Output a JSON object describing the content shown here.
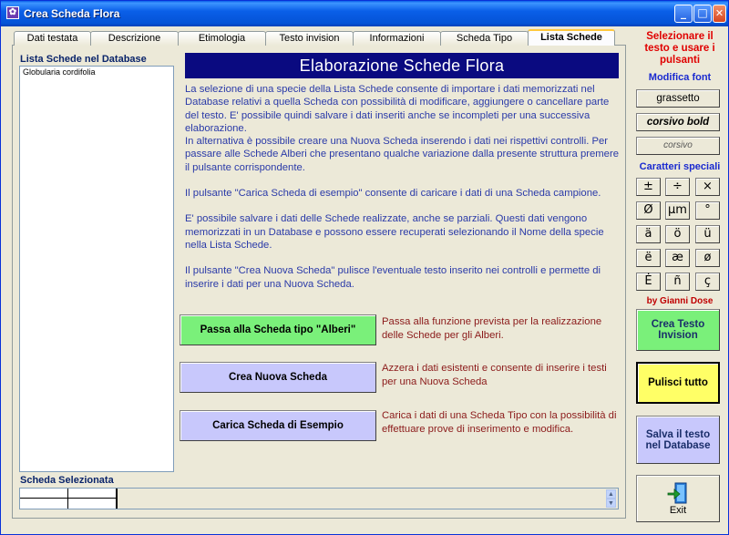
{
  "window": {
    "title": "Crea Scheda Flora"
  },
  "tabs": [
    {
      "label": "Dati testata"
    },
    {
      "label": "Descrizione"
    },
    {
      "label": "Etimologia"
    },
    {
      "label": "Testo invision"
    },
    {
      "label": "Informazioni"
    },
    {
      "label": "Scheda Tipo"
    },
    {
      "label": "Lista Schede"
    }
  ],
  "list": {
    "label": "Lista Schede nel Database",
    "items": [
      "Globularia cordifolia"
    ]
  },
  "main": {
    "header": "Elaborazione Schede Flora",
    "paragraphs": [
      "La selezione di una specie della Lista Schede consente di importare i dati memorizzati nel Database relativi a quella Scheda con possibilità di modificare, aggiungere o cancellare parte del testo. E' possibile quindi salvare i dati inseriti anche se incompleti per una successiva elaborazione.",
      "In alternativa è possibile creare una Nuova Scheda inserendo i dati nei rispettivi controlli. Per passare alle Schede Alberi che presentano qualche variazione dalla presente struttura premere il pulsante corrispondente.",
      "Il pulsante \"Carica Scheda di esempio\" consente di caricare i dati di una Scheda campione.",
      "E' possibile salvare i dati delle Schede realizzate, anche se parziali. Questi dati vengono memorizzati in un Database e possono essere recuperati selezionando il Nome della specie nella Lista Schede.",
      "Il pulsante \"Crea Nuova Scheda\" pulisce l'eventuale testo inserito nei controlli e permette di inserire i dati per una Nuova Scheda."
    ],
    "actions": {
      "alberi": {
        "label": "Passa alla Scheda tipo \"Alberi\"",
        "desc": "Passa alla funzione prevista per la realizzazione delle Schede per gli Alberi."
      },
      "nuova": {
        "label": "Crea Nuova Scheda",
        "desc": "Azzera i dati esistenti e consente di inserire i testi per una  Nuova Scheda"
      },
      "carica": {
        "label": "Carica Scheda di Esempio",
        "desc": "Carica i dati di una Scheda Tipo con la possibilità di effettuare prove di inserimento e modifica."
      }
    }
  },
  "selected": {
    "label": "Scheda Selezionata"
  },
  "side": {
    "note": "Selezionare il testo e usare i pulsanti",
    "font_label": "Modifica font",
    "font_buttons": [
      "grassetto",
      "corsivo bold",
      "corsivo"
    ],
    "chars_label": "Caratteri speciali",
    "chars": [
      "±",
      "÷",
      "×",
      "Ø",
      "µm",
      "°",
      "ä",
      "ö",
      "ü",
      "ë",
      "æ",
      "ø",
      "Ė",
      "ñ",
      "ç"
    ],
    "byline": "by Gianni Dose",
    "invision_label": "Crea Testo Invision",
    "pulisci_label": "Pulisci tutto",
    "salva_label": "Salva il testo nel Database",
    "exit_label": "Exit"
  },
  "colors": {
    "header_bg": "#0a0a80",
    "green_button": "#7af07a",
    "lavender_button": "#c8c8fc",
    "yellow_button": "#ffff66",
    "description_text": "#2a3aa8",
    "action_text": "#8b1a1a"
  }
}
